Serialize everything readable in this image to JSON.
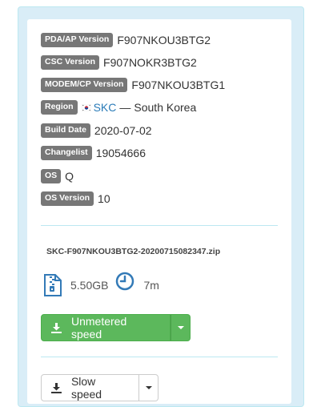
{
  "info": [
    {
      "label": "PDA/AP Version",
      "value": "F907NKOU3BTG2"
    },
    {
      "label": "CSC Version",
      "value": "F907NOKR3BTG2"
    },
    {
      "label": "MODEM/CP Version",
      "value": "F907NKOU3BTG1"
    },
    {
      "label": "Region",
      "region_code": "SKC",
      "region_sep": "—",
      "region_name": "South Korea"
    },
    {
      "label": "Build Date",
      "value": "2020-07-02"
    },
    {
      "label": "Changelist",
      "value": "19054666"
    },
    {
      "label": "OS",
      "value": "Q"
    },
    {
      "label": "OS Version",
      "value": "10"
    }
  ],
  "file": {
    "name": "SKC-F907NKOU3BTG2-20200715082347.zip",
    "size": "5.50GB",
    "time": "7m",
    "icons": {
      "file": "zip-file-icon",
      "time": "clock-icon"
    }
  },
  "downloads": {
    "fast_label": "Unmetered speed",
    "slow_label": "Slow speed",
    "icon": "download-icon"
  },
  "colors": {
    "panel_bg": "#d9edf7",
    "label_bg": "#777777",
    "accent_blue": "#2a7bb8",
    "button_green": "#5cb85c"
  }
}
